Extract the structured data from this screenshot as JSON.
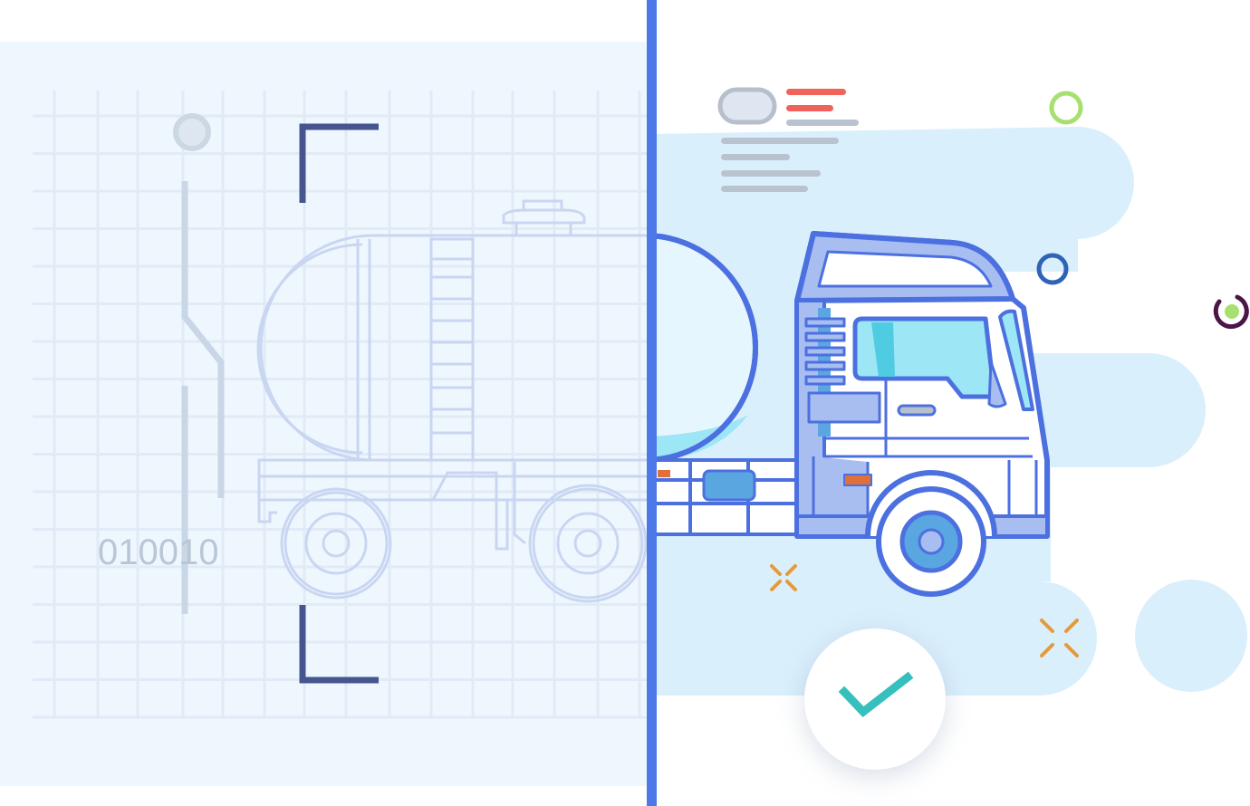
{
  "scan_panel": {
    "binary_code": "010010"
  },
  "confirm": {
    "icon": "check-icon",
    "color": "#36c0bd"
  },
  "colors": {
    "divider": "#4c78e8",
    "truck_outline": "#4c70e0",
    "blueprint_line": "#c9d6f2",
    "grid_line": "#e1eaf6",
    "accent_red": "#f0625a",
    "accent_green": "#a8e06f",
    "accent_orange": "#e59a3a",
    "accent_purple": "#4a1646"
  }
}
